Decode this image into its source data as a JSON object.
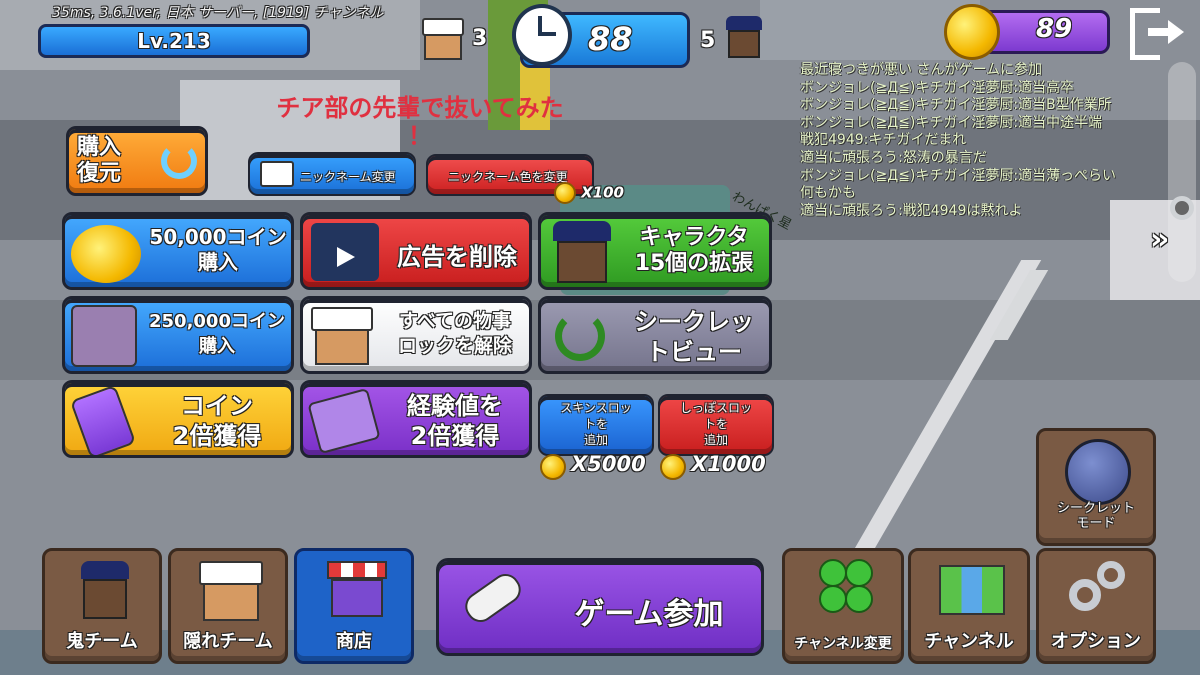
{
  "status": {
    "info": "35ms, 3.6.1ver, 日本 サーバー, [1919] チャンネル",
    "level": "Lv.213"
  },
  "topbar": {
    "box_count": "3",
    "timer": "88",
    "seeker_count": "5",
    "coins": "89"
  },
  "banner": {
    "line1": "チア部の先輩で抜いてみた",
    "line2": "！"
  },
  "buttons": {
    "purchase_restore": "購入\n復元",
    "nickname_change": "ニックネーム変更",
    "nickname_color": "ニックネーム色を変更",
    "nickname_color_price": "X100",
    "coins50k": "50,000コイン\n購入",
    "remove_ads": "広告を削除",
    "char_expand": "キャラクタ\n15個の拡張",
    "coins250k": "250,000コイン\n購入",
    "unlock_props": "すべての物事\nロックを解除",
    "secret_view": "シークレッ\nトビュー",
    "coin_double": "コイン\n2倍獲得",
    "exp_double": "経験値を\n2倍獲得",
    "skin_slot": "スキンスロッ\nトを\n追加",
    "skin_slot_price": "X5000",
    "tail_slot": "しっぽスロッ\nトを\n追加",
    "tail_slot_price": "X1000",
    "secret_mode": "シークレット\nモード",
    "join_game": "ゲーム参加"
  },
  "bottom_nav": [
    {
      "label": "鬼チーム"
    },
    {
      "label": "隠れチーム"
    },
    {
      "label": "商店"
    }
  ],
  "right_nav": [
    {
      "label": "チャンネル変更"
    },
    {
      "label": "チャンネル"
    },
    {
      "label": "オプション"
    }
  ],
  "world_text": "わんぱく星",
  "chat": [
    "最近寝つきが悪い さんがゲームに参加",
    "ボンジョレ(≧Д≦)キチガイ淫夢厨:適当高卒",
    "ボンジョレ(≧Д≦)キチガイ淫夢厨:適当B型作業所",
    "ボンジョレ(≧Д≦)キチガイ淫夢厨:適当中途半端",
    "戦犯4949:キチガイだまれ",
    "適当に頑張ろう:怒涛の暴言だ",
    "ボンジョレ(≧Д≦)キチガイ淫夢厨:適当薄っぺらい",
    "何もかも",
    "適当に頑張ろう:戦犯4949は黙れよ"
  ],
  "colors": {
    "blue": "#2f8be6",
    "red": "#e03a3a",
    "green": "#3fb52f",
    "purple": "#8a3fd6",
    "gray": "#8b8aa0",
    "yellow": "#f5c21a",
    "shop_blue": "#1e63c8"
  }
}
